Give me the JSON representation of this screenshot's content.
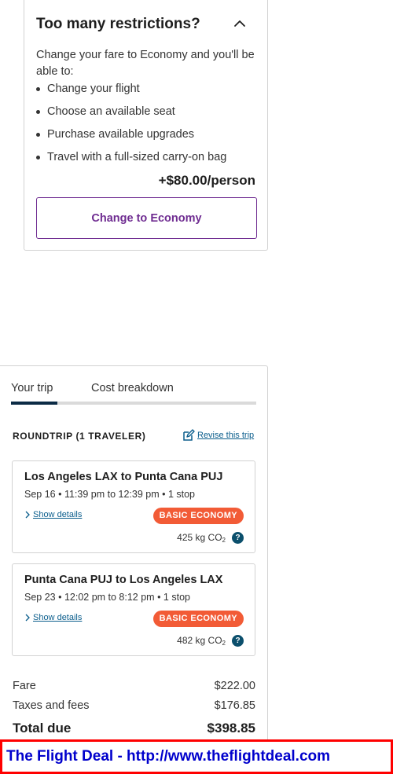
{
  "upsell": {
    "title": "Too many restrictions?",
    "intro": "Change your fare to Economy and you'll be able to:",
    "benefits": [
      "Change your flight",
      "Choose an available seat",
      "Purchase available upgrades",
      "Travel with a full-sized carry-on bag"
    ],
    "price_per_person": "+$80.00/person",
    "button_label": "Change to Economy",
    "accent_color": "#6f2c91",
    "collapse_icon": "chevron-up-icon"
  },
  "summary": {
    "tabs": [
      {
        "label": "Your trip",
        "active": true
      },
      {
        "label": "Cost breakdown",
        "active": false
      }
    ],
    "trip_heading": "ROUNDTRIP (1 TRAVELER)",
    "revise_link": "Revise this trip",
    "revise_icon": "edit-icon",
    "segments": [
      {
        "route": "Los Angeles LAX to Punta Cana PUJ",
        "time": "Sep 16 • 11:39 pm to 12:39 pm • 1 stop",
        "details_link": "Show details",
        "badge": "BASIC ECONOMY",
        "co2_value": "425 kg CO",
        "co2_sub": "2",
        "help_icon": "?"
      },
      {
        "route": "Punta Cana PUJ to Los Angeles LAX",
        "time": "Sep 23 • 12:02 pm to 8:12 pm • 1 stop",
        "details_link": "Show details",
        "badge": "BASIC ECONOMY",
        "co2_value": "482 kg CO",
        "co2_sub": "2",
        "help_icon": "?"
      }
    ],
    "costs": {
      "fare_label": "Fare",
      "fare_value": "$222.00",
      "taxes_label": "Taxes and fees",
      "taxes_value": "$176.85",
      "total_label": "Total due",
      "total_value": "$398.85"
    },
    "badge_color": "#f25b36",
    "tab_active_color": "#0b2b45"
  },
  "banner": {
    "text": "The Flight Deal - http://www.theflightdeal.com",
    "text_color": "#0000cc",
    "border_color": "#ff0000"
  }
}
